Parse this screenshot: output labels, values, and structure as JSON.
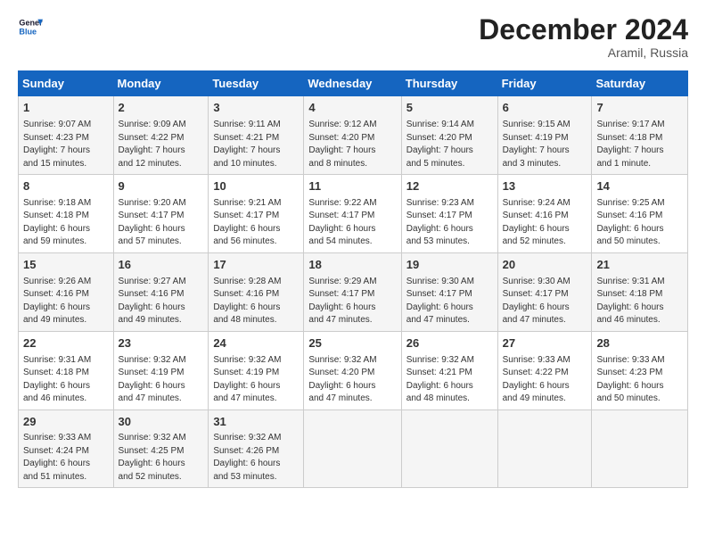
{
  "header": {
    "logo_line1": "General",
    "logo_line2": "Blue",
    "month_title": "December 2024",
    "location": "Aramil, Russia"
  },
  "days_of_week": [
    "Sunday",
    "Monday",
    "Tuesday",
    "Wednesday",
    "Thursday",
    "Friday",
    "Saturday"
  ],
  "weeks": [
    [
      {
        "day": "1",
        "info": "Sunrise: 9:07 AM\nSunset: 4:23 PM\nDaylight: 7 hours\nand 15 minutes."
      },
      {
        "day": "2",
        "info": "Sunrise: 9:09 AM\nSunset: 4:22 PM\nDaylight: 7 hours\nand 12 minutes."
      },
      {
        "day": "3",
        "info": "Sunrise: 9:11 AM\nSunset: 4:21 PM\nDaylight: 7 hours\nand 10 minutes."
      },
      {
        "day": "4",
        "info": "Sunrise: 9:12 AM\nSunset: 4:20 PM\nDaylight: 7 hours\nand 8 minutes."
      },
      {
        "day": "5",
        "info": "Sunrise: 9:14 AM\nSunset: 4:20 PM\nDaylight: 7 hours\nand 5 minutes."
      },
      {
        "day": "6",
        "info": "Sunrise: 9:15 AM\nSunset: 4:19 PM\nDaylight: 7 hours\nand 3 minutes."
      },
      {
        "day": "7",
        "info": "Sunrise: 9:17 AM\nSunset: 4:18 PM\nDaylight: 7 hours\nand 1 minute."
      }
    ],
    [
      {
        "day": "8",
        "info": "Sunrise: 9:18 AM\nSunset: 4:18 PM\nDaylight: 6 hours\nand 59 minutes."
      },
      {
        "day": "9",
        "info": "Sunrise: 9:20 AM\nSunset: 4:17 PM\nDaylight: 6 hours\nand 57 minutes."
      },
      {
        "day": "10",
        "info": "Sunrise: 9:21 AM\nSunset: 4:17 PM\nDaylight: 6 hours\nand 56 minutes."
      },
      {
        "day": "11",
        "info": "Sunrise: 9:22 AM\nSunset: 4:17 PM\nDaylight: 6 hours\nand 54 minutes."
      },
      {
        "day": "12",
        "info": "Sunrise: 9:23 AM\nSunset: 4:17 PM\nDaylight: 6 hours\nand 53 minutes."
      },
      {
        "day": "13",
        "info": "Sunrise: 9:24 AM\nSunset: 4:16 PM\nDaylight: 6 hours\nand 52 minutes."
      },
      {
        "day": "14",
        "info": "Sunrise: 9:25 AM\nSunset: 4:16 PM\nDaylight: 6 hours\nand 50 minutes."
      }
    ],
    [
      {
        "day": "15",
        "info": "Sunrise: 9:26 AM\nSunset: 4:16 PM\nDaylight: 6 hours\nand 49 minutes."
      },
      {
        "day": "16",
        "info": "Sunrise: 9:27 AM\nSunset: 4:16 PM\nDaylight: 6 hours\nand 49 minutes."
      },
      {
        "day": "17",
        "info": "Sunrise: 9:28 AM\nSunset: 4:16 PM\nDaylight: 6 hours\nand 48 minutes."
      },
      {
        "day": "18",
        "info": "Sunrise: 9:29 AM\nSunset: 4:17 PM\nDaylight: 6 hours\nand 47 minutes."
      },
      {
        "day": "19",
        "info": "Sunrise: 9:30 AM\nSunset: 4:17 PM\nDaylight: 6 hours\nand 47 minutes."
      },
      {
        "day": "20",
        "info": "Sunrise: 9:30 AM\nSunset: 4:17 PM\nDaylight: 6 hours\nand 47 minutes."
      },
      {
        "day": "21",
        "info": "Sunrise: 9:31 AM\nSunset: 4:18 PM\nDaylight: 6 hours\nand 46 minutes."
      }
    ],
    [
      {
        "day": "22",
        "info": "Sunrise: 9:31 AM\nSunset: 4:18 PM\nDaylight: 6 hours\nand 46 minutes."
      },
      {
        "day": "23",
        "info": "Sunrise: 9:32 AM\nSunset: 4:19 PM\nDaylight: 6 hours\nand 47 minutes."
      },
      {
        "day": "24",
        "info": "Sunrise: 9:32 AM\nSunset: 4:19 PM\nDaylight: 6 hours\nand 47 minutes."
      },
      {
        "day": "25",
        "info": "Sunrise: 9:32 AM\nSunset: 4:20 PM\nDaylight: 6 hours\nand 47 minutes."
      },
      {
        "day": "26",
        "info": "Sunrise: 9:32 AM\nSunset: 4:21 PM\nDaylight: 6 hours\nand 48 minutes."
      },
      {
        "day": "27",
        "info": "Sunrise: 9:33 AM\nSunset: 4:22 PM\nDaylight: 6 hours\nand 49 minutes."
      },
      {
        "day": "28",
        "info": "Sunrise: 9:33 AM\nSunset: 4:23 PM\nDaylight: 6 hours\nand 50 minutes."
      }
    ],
    [
      {
        "day": "29",
        "info": "Sunrise: 9:33 AM\nSunset: 4:24 PM\nDaylight: 6 hours\nand 51 minutes."
      },
      {
        "day": "30",
        "info": "Sunrise: 9:32 AM\nSunset: 4:25 PM\nDaylight: 6 hours\nand 52 minutes."
      },
      {
        "day": "31",
        "info": "Sunrise: 9:32 AM\nSunset: 4:26 PM\nDaylight: 6 hours\nand 53 minutes."
      },
      {
        "day": "",
        "info": ""
      },
      {
        "day": "",
        "info": ""
      },
      {
        "day": "",
        "info": ""
      },
      {
        "day": "",
        "info": ""
      }
    ]
  ]
}
